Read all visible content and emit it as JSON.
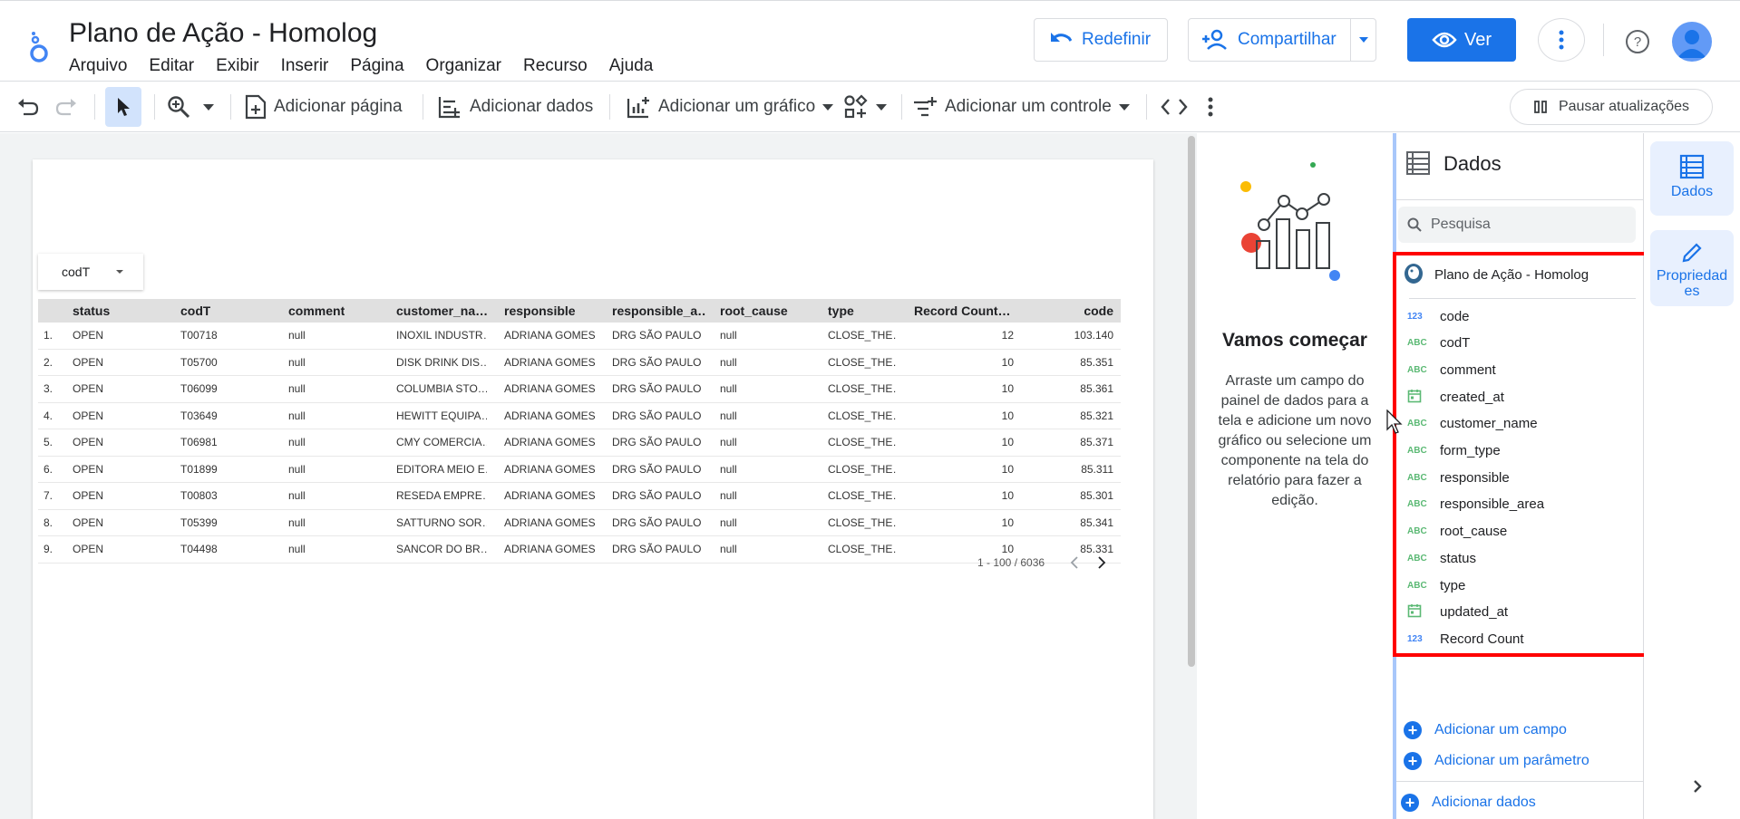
{
  "app": {
    "title": "Plano de Ação - Homolog",
    "menu": [
      "Arquivo",
      "Editar",
      "Exibir",
      "Inserir",
      "Página",
      "Organizar",
      "Recurso",
      "Ajuda"
    ]
  },
  "header": {
    "redefinir_label": "Redefinir",
    "share_label": "Compartilhar",
    "ver_label": "Ver"
  },
  "toolbar": {
    "add_page": "Adicionar página",
    "add_data": "Adicionar dados",
    "add_chart": "Adicionar um gráfico",
    "add_control": "Adicionar um controle",
    "pause": "Pausar atualizações"
  },
  "report": {
    "filter_label": "codT",
    "columns": [
      "status",
      "codT",
      "comment",
      "customer_na…",
      "responsible",
      "responsible_a…",
      "root_cause",
      "type",
      "Record Count…",
      "code"
    ],
    "rows": [
      [
        "1.",
        "OPEN",
        "T00718",
        "null",
        "INOXIL INDUSTR…",
        "ADRIANA GOMES",
        "DRG SÃO PAULO",
        "null",
        "CLOSE_THE…",
        "12",
        "103.140"
      ],
      [
        "2.",
        "OPEN",
        "T05700",
        "null",
        "DISK DRINK DIS…",
        "ADRIANA GOMES",
        "DRG SÃO PAULO",
        "null",
        "CLOSE_THE…",
        "10",
        "85.351"
      ],
      [
        "3.",
        "OPEN",
        "T06099",
        "null",
        "COLUMBIA STO…",
        "ADRIANA GOMES",
        "DRG SÃO PAULO",
        "null",
        "CLOSE_THE…",
        "10",
        "85.361"
      ],
      [
        "4.",
        "OPEN",
        "T03649",
        "null",
        "HEWITT EQUIPA…",
        "ADRIANA GOMES",
        "DRG SÃO PAULO",
        "null",
        "CLOSE_THE…",
        "10",
        "85.321"
      ],
      [
        "5.",
        "OPEN",
        "T06981",
        "null",
        "CMY COMERCIA…",
        "ADRIANA GOMES",
        "DRG SÃO PAULO",
        "null",
        "CLOSE_THE…",
        "10",
        "85.371"
      ],
      [
        "6.",
        "OPEN",
        "T01899",
        "null",
        "EDITORA MEIO E…",
        "ADRIANA GOMES",
        "DRG SÃO PAULO",
        "null",
        "CLOSE_THE…",
        "10",
        "85.311"
      ],
      [
        "7.",
        "OPEN",
        "T00803",
        "null",
        "RESEDA EMPRE…",
        "ADRIANA GOMES",
        "DRG SÃO PAULO",
        "null",
        "CLOSE_THE…",
        "10",
        "85.301"
      ],
      [
        "8.",
        "OPEN",
        "T05399",
        "null",
        "SATTURNO SOR…",
        "ADRIANA GOMES",
        "DRG SÃO PAULO",
        "null",
        "CLOSE_THE…",
        "10",
        "85.341"
      ],
      [
        "9.",
        "OPEN",
        "T04498",
        "null",
        "SANCOR DO BR…",
        "ADRIANA GOMES",
        "DRG SÃO PAULO",
        "null",
        "CLOSE_THE…",
        "10",
        "85.331"
      ]
    ],
    "pager": "1 - 100 / 6036"
  },
  "empty_state": {
    "title": "Vamos começar",
    "text": "Arraste um campo do painel de dados para a tela e adicione um novo gráfico ou selecione um componente na tela do relatório para fazer a edição."
  },
  "data_panel": {
    "title": "Dados",
    "search_placeholder": "Pesquisa",
    "datasource": "Plano de Ação - Homolog",
    "fields": [
      {
        "type": "123",
        "name": "code"
      },
      {
        "type": "ABC",
        "name": "codT"
      },
      {
        "type": "ABC",
        "name": "comment"
      },
      {
        "type": "date",
        "name": "created_at"
      },
      {
        "type": "ABC",
        "name": "customer_name"
      },
      {
        "type": "ABC",
        "name": "form_type"
      },
      {
        "type": "ABC",
        "name": "responsible"
      },
      {
        "type": "ABC",
        "name": "responsible_area"
      },
      {
        "type": "ABC",
        "name": "root_cause"
      },
      {
        "type": "ABC",
        "name": "status"
      },
      {
        "type": "ABC",
        "name": "type"
      },
      {
        "type": "date",
        "name": "updated_at"
      },
      {
        "type": "123",
        "name": "Record Count"
      }
    ],
    "add_field": "Adicionar um campo",
    "add_param": "Adicionar um parâmetro",
    "add_data": "Adicionar dados"
  },
  "rail": {
    "dados": "Dados",
    "propriedades": "Propriedad es"
  },
  "colors": {
    "accent": "#1a73e8",
    "highlight_box": "#ff0000"
  }
}
